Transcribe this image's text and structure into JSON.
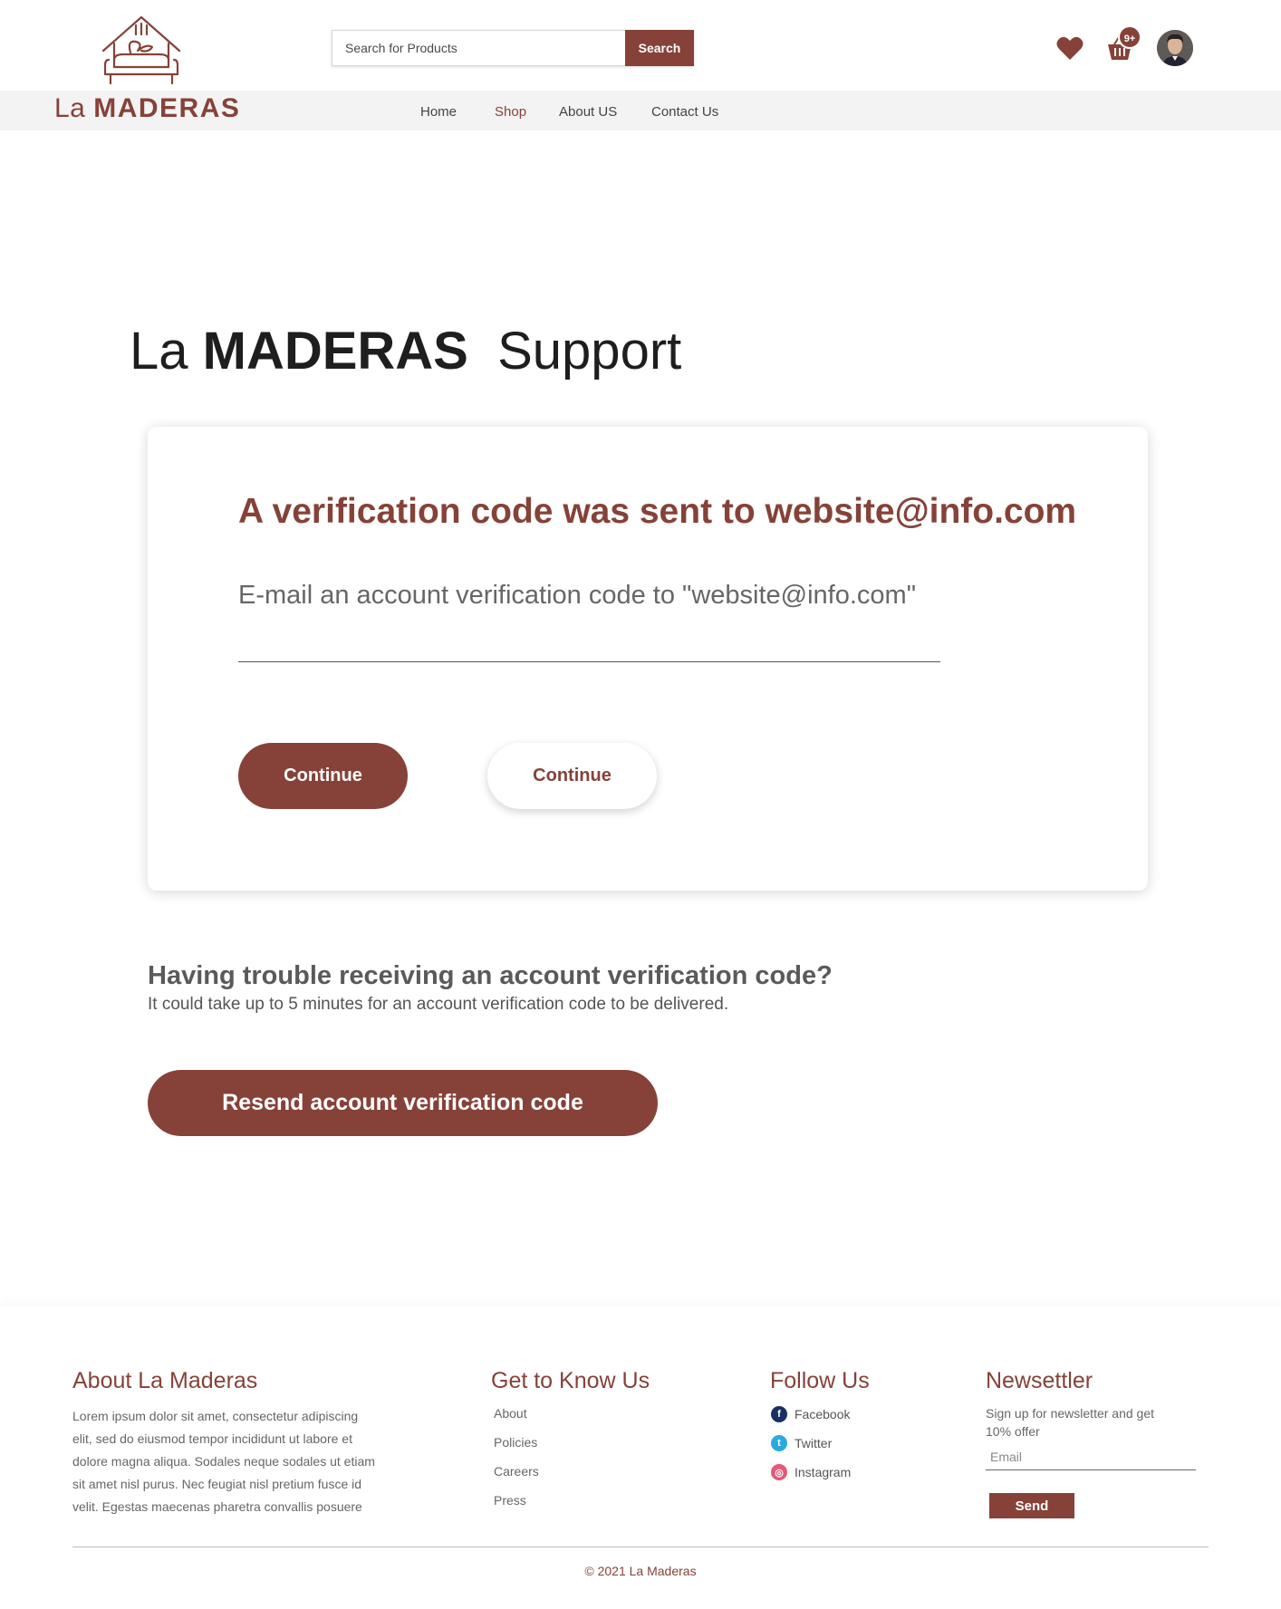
{
  "brand": {
    "logo_text_light": "La",
    "logo_text_bold": "MADERAS",
    "primary_color": "#864238"
  },
  "header": {
    "search_placeholder": "Search for Products",
    "search_button": "Search",
    "cart_badge": "9+",
    "icons": [
      "heart-icon",
      "cart-icon",
      "avatar"
    ]
  },
  "nav": {
    "items": [
      {
        "label": "Home",
        "active": false
      },
      {
        "label": "Shop",
        "active": true
      },
      {
        "label": "About US",
        "active": false
      },
      {
        "label": "Contact Us",
        "active": false
      }
    ]
  },
  "main": {
    "title_light": "La",
    "title_bold": "MADERAS",
    "title_suffix": "Support",
    "card": {
      "heading": "A verification code was sent to website@info.com",
      "subtext": "E-mail an account verification code to \"website@info.com\"",
      "primary_button": "Continue",
      "secondary_button": "Continue"
    },
    "trouble": {
      "title": "Having trouble receiving an account verification code?",
      "subtitle": "It could take up to 5 minutes for an account verification code to be delivered.",
      "resend_button": "Resend account verification code"
    }
  },
  "footer": {
    "about": {
      "title": "About La Maderas",
      "text": "Lorem ipsum dolor sit amet, consectetur adipiscing elit, sed do eiusmod tempor incididunt ut labore et dolore magna aliqua. Sodales neque sodales ut etiam sit amet nisl purus. Nec feugiat nisl pretium fusce id velit. Egestas maecenas pharetra convallis posuere"
    },
    "know": {
      "title": "Get to Know Us",
      "links": [
        "About",
        "Policies",
        "Careers",
        "Press"
      ]
    },
    "follow": {
      "title": "Follow Us",
      "links": [
        {
          "label": "Facebook",
          "icon": "facebook-icon"
        },
        {
          "label": "Twitter",
          "icon": "twitter-icon"
        },
        {
          "label": "Instagram",
          "icon": "instagram-icon"
        }
      ]
    },
    "newsletter": {
      "title": "Newsettler",
      "text": "Sign up for newsletter and get 10% offer",
      "email_placeholder": "Email",
      "send_button": "Send"
    },
    "copyright": "© 2021 La Maderas"
  }
}
